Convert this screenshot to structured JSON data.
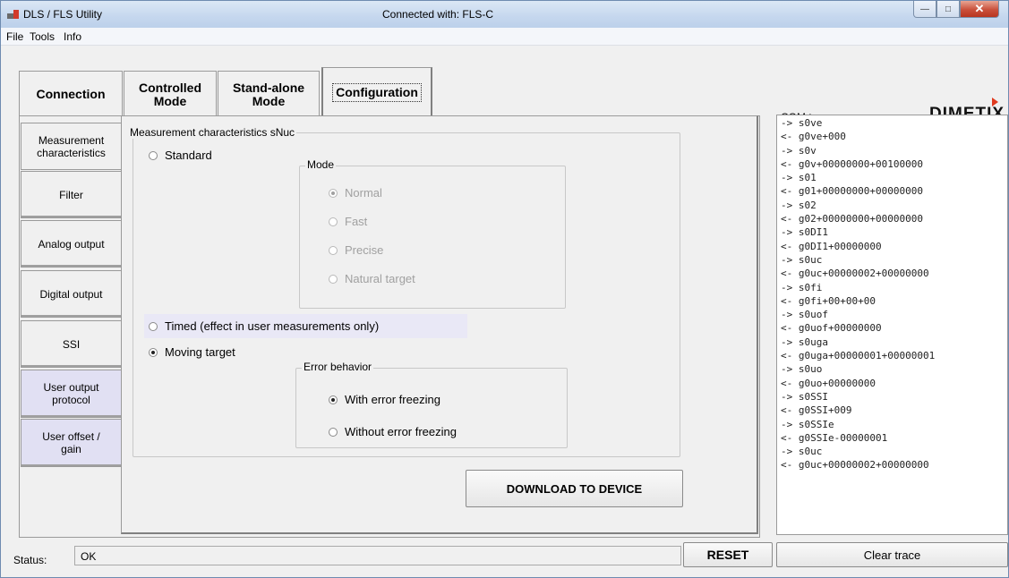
{
  "window": {
    "title": "DLS / FLS Utility",
    "connection_status": "Connected with: FLS-C"
  },
  "menu": [
    "File",
    "Tools",
    "Info"
  ],
  "tabs": {
    "connection": "Connection",
    "controlled_1": "Controlled",
    "controlled_2": "Mode",
    "standalone_1": "Stand-alone",
    "standalone_2": "Mode",
    "configuration": "Configuration",
    "active": "Configuration"
  },
  "side_tabs": {
    "measurement_1": "Measurement",
    "measurement_2": "characteristics",
    "filter": "Filter",
    "analog": "Analog output",
    "digital": "Digital output",
    "ssi": "SSI",
    "user_output_1": "User output",
    "user_output_2": "protocol",
    "user_offset_1": "User offset /",
    "user_offset_2": "gain"
  },
  "measurement": {
    "group_title": "Measurement characteristics sNuc",
    "standard": "Standard",
    "mode_title": "Mode",
    "modes": {
      "normal": "Normal",
      "fast": "Fast",
      "precise": "Precise",
      "natural": "Natural target"
    },
    "timed": "Timed (effect in user measurements only)",
    "moving": "Moving target",
    "error_title": "Error behavior",
    "with_freezing": "With error freezing",
    "without_freezing": "Without error freezing",
    "download_button": "DOWNLOAD TO DEVICE"
  },
  "trace": {
    "label": "COM trace",
    "logo": "DIMETIX",
    "lines": [
      "-> s0ve",
      "<- g0ve+000",
      "-> s0v",
      "<- g0v+00000000+00100000",
      "-> s01",
      "<- g01+00000000+00000000",
      "-> s02",
      "<- g02+00000000+00000000",
      "-> s0DI1",
      "<- g0DI1+00000000",
      "-> s0uc",
      "<- g0uc+00000002+00000000",
      "-> s0fi",
      "<- g0fi+00+00+00",
      "-> s0uof",
      "<- g0uof+00000000",
      "-> s0uga",
      "<- g0uga+00000001+00000001",
      "-> s0uo",
      "<- g0uo+00000000",
      "-> s0SSI",
      "<- g0SSI+009",
      "-> s0SSIe",
      "<- g0SSIe-00000001",
      "-> s0uc",
      "<- g0uc+00000002+00000000"
    ],
    "clear_button": "Clear trace"
  },
  "status": {
    "label": "Status:",
    "value": "OK",
    "reset_button": "RESET"
  }
}
